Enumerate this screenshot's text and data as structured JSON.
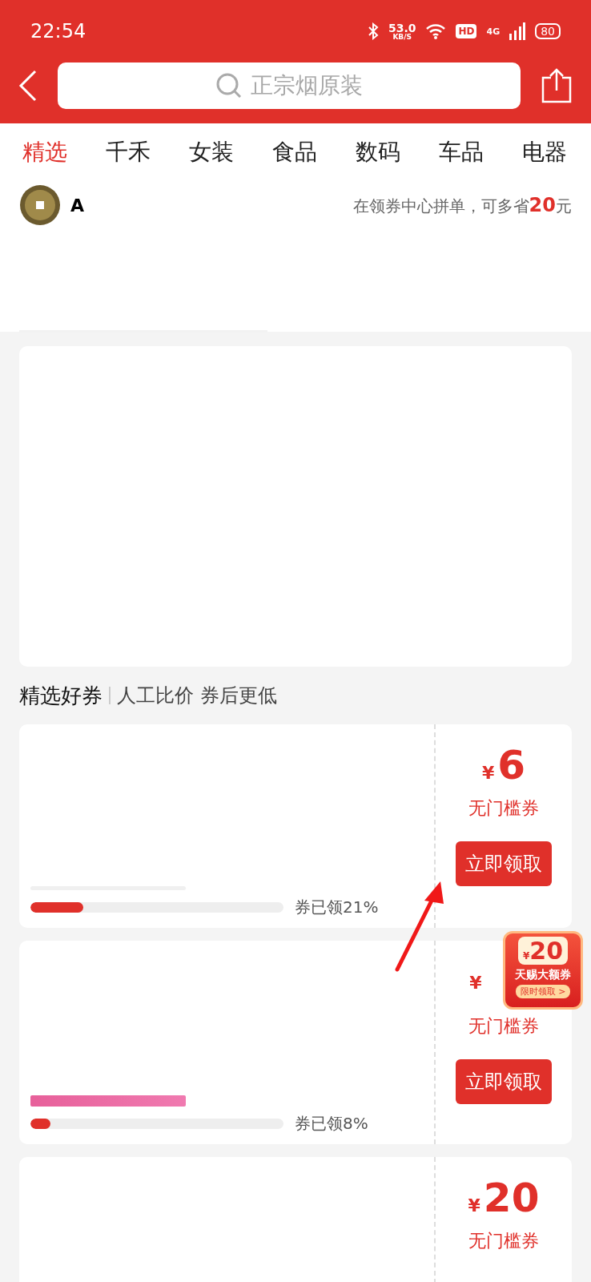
{
  "status_bar": {
    "time": "22:54",
    "speed": "53.0",
    "speed_unit": "KB/S",
    "hd": "HD",
    "network": "4G",
    "battery": "80"
  },
  "search": {
    "placeholder": "正宗烟原装"
  },
  "tabs": [
    {
      "label": "精选",
      "selected": true
    },
    {
      "label": "千禾",
      "selected": false
    },
    {
      "label": "女装",
      "selected": false
    },
    {
      "label": "食品",
      "selected": false
    },
    {
      "label": "数码",
      "selected": false
    },
    {
      "label": "车品",
      "selected": false
    },
    {
      "label": "电器",
      "selected": false
    }
  ],
  "promo_row": {
    "name": "A",
    "text": "在领券中心拼单，可多省",
    "amount": "20",
    "unit": "元"
  },
  "section": {
    "title": "精选好券",
    "subtitle": "人工比价 券后更低"
  },
  "coupons": [
    {
      "currency": "¥",
      "amount": "6",
      "type": "无门槛券",
      "button": "立即领取",
      "level": 0.21,
      "claimed": "券已领21%",
      "tag": false
    },
    {
      "currency": "¥",
      "type": "无门槛券",
      "button": "立即领取",
      "level": 0.08,
      "claimed": "券已领8%",
      "tag": true
    },
    {
      "currency": "¥",
      "amount": "20",
      "type": "无门槛券"
    }
  ],
  "floating_badge": {
    "currency": "¥",
    "amount": "20",
    "title": "天赐大额券",
    "action": "限时领取 >"
  }
}
